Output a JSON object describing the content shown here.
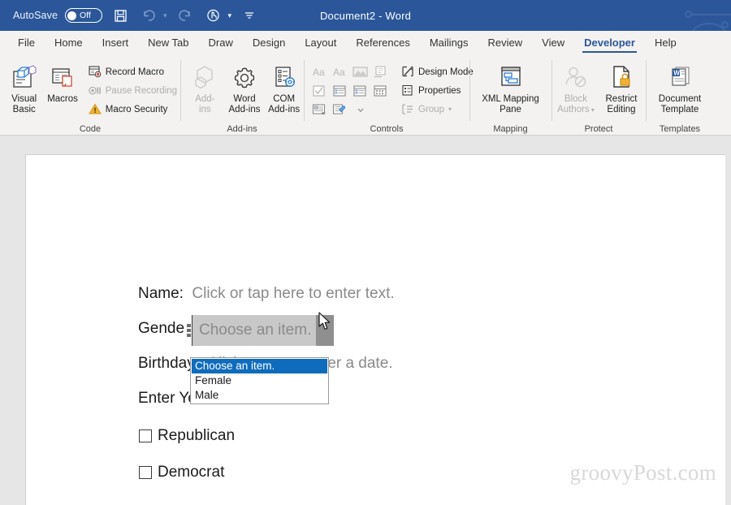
{
  "titlebar": {
    "autosave_label": "AutoSave",
    "autosave_state": "Off",
    "document_title": "Document2  -  Word",
    "quick_access": [
      {
        "name": "save-icon",
        "label": "Save",
        "enabled": true
      },
      {
        "name": "undo-icon",
        "label": "Undo",
        "enabled": false
      },
      {
        "name": "redo-icon",
        "label": "Redo",
        "enabled": false
      },
      {
        "name": "touch-mode-icon",
        "label": "Touch/Mouse Mode",
        "enabled": true
      },
      {
        "name": "customize-quick-access-icon",
        "label": "Customize Quick Access Toolbar",
        "enabled": true
      }
    ],
    "accent_color": "#2b579a"
  },
  "tabs": [
    {
      "label": "File",
      "active": false
    },
    {
      "label": "Home",
      "active": false
    },
    {
      "label": "Insert",
      "active": false
    },
    {
      "label": "New Tab",
      "active": false
    },
    {
      "label": "Draw",
      "active": false
    },
    {
      "label": "Design",
      "active": false
    },
    {
      "label": "Layout",
      "active": false
    },
    {
      "label": "References",
      "active": false
    },
    {
      "label": "Mailings",
      "active": false
    },
    {
      "label": "Review",
      "active": false
    },
    {
      "label": "View",
      "active": false
    },
    {
      "label": "Developer",
      "active": true
    },
    {
      "label": "Help",
      "active": false
    }
  ],
  "ribbon": {
    "groups": [
      {
        "label": "Code"
      },
      {
        "label": "Add-ins"
      },
      {
        "label": "Controls"
      },
      {
        "label": "Mapping"
      },
      {
        "label": "Protect"
      },
      {
        "label": "Templates"
      }
    ],
    "code": {
      "visual_basic": "Visual\nBasic",
      "macros": "Macros",
      "record_macro": "Record Macro",
      "pause_recording": "Pause Recording",
      "macro_security": "Macro Security"
    },
    "addins": {
      "addins": "Add-\nins",
      "word_addins": "Word\nAdd-ins",
      "com_addins": "COM\nAdd-ins"
    },
    "controls": {
      "design_mode": "Design Mode",
      "properties": "Properties",
      "group": "Group",
      "icons": [
        "rich-text-content-control-icon",
        "plain-text-content-control-icon",
        "picture-content-control-icon",
        "repeating-section-content-control-icon",
        "check-box-content-control-icon",
        "combo-box-content-control-icon",
        "drop-down-list-content-control-icon",
        "date-picker-content-control-icon",
        "building-block-gallery-content-control-icon",
        "legacy-tools-icon"
      ]
    },
    "mapping": {
      "xml_mapping_pane": "XML Mapping\nPane"
    },
    "protect": {
      "block_authors": "Block\nAuthors",
      "restrict_editing": "Restrict\nEditing"
    },
    "templates": {
      "document_template": "Document\nTemplate"
    }
  },
  "document": {
    "name_label": "Name:",
    "name_placeholder": "Click or tap here to enter text.",
    "gender_label": "Gender:",
    "gender_value": "Choose an item.",
    "birthday_label": "Birthday:",
    "birthday_placeholder": "Click or tap to enter a date.",
    "vote_label": "Enter Your Vote:",
    "checkboxes": [
      {
        "label": "Republican",
        "checked": false
      },
      {
        "label": "Democrat",
        "checked": false
      }
    ],
    "watermark": "groovyPost.com"
  },
  "dropdown": {
    "open": true,
    "highlight_color": "#0f6cbd",
    "items": [
      {
        "label": "Choose an item.",
        "selected": true
      },
      {
        "label": "Female",
        "selected": false
      },
      {
        "label": "Male",
        "selected": false
      }
    ]
  }
}
